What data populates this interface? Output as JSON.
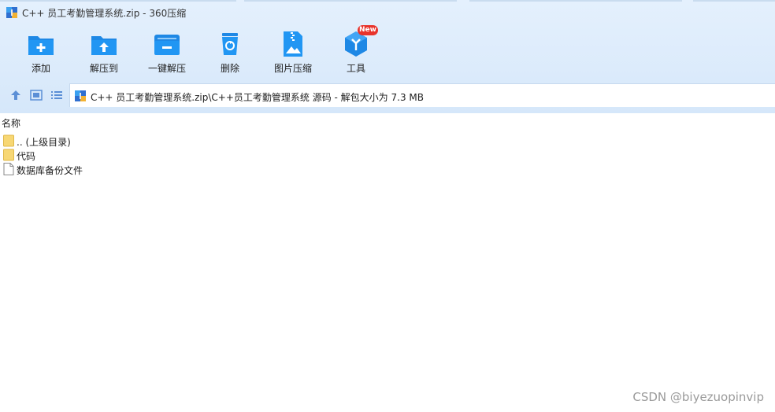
{
  "window": {
    "title": "C++ 员工考勤管理系统.zip - 360压缩"
  },
  "toolbar": {
    "items": [
      {
        "label": "添加",
        "icon": "add-folder-icon"
      },
      {
        "label": "解压到",
        "icon": "extract-to-icon"
      },
      {
        "label": "一键解压",
        "icon": "one-click-extract-icon"
      },
      {
        "label": "删除",
        "icon": "delete-icon"
      },
      {
        "label": "图片压缩",
        "icon": "image-compress-icon"
      },
      {
        "label": "工具",
        "icon": "tools-icon"
      }
    ],
    "new_badge": "New"
  },
  "nav": {
    "path": "C++ 员工考勤管理系统.zip\\C++员工考勤管理系统 源码 - 解包大小为 7.3 MB"
  },
  "list": {
    "column_name": "名称",
    "rows": [
      {
        "label": ".. (上级目录)",
        "icon": "folder-icon"
      },
      {
        "label": "代码",
        "icon": "folder-icon"
      },
      {
        "label": "数据库备份文件",
        "icon": "file-icon"
      }
    ]
  },
  "watermark": "CSDN @biyezuopinvip",
  "colors": {
    "accent": "#1e88e5",
    "folder": "#f7d774",
    "badge": "#e8332b"
  }
}
